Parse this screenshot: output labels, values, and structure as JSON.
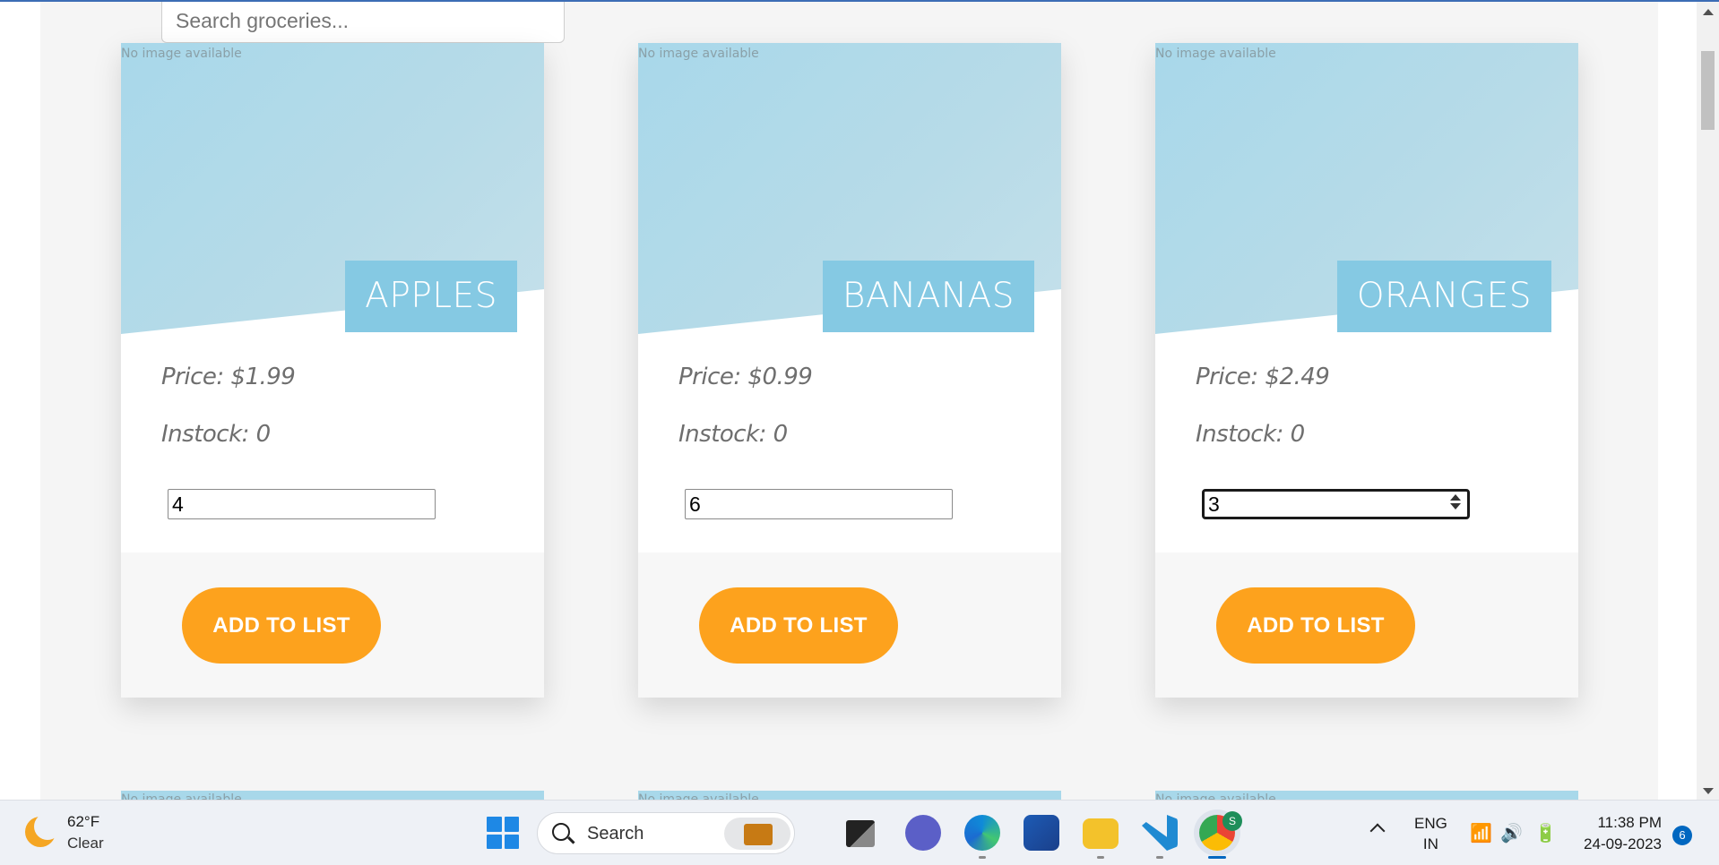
{
  "search": {
    "placeholder": "Search groceries..."
  },
  "products": [
    {
      "name": "APPLES",
      "image_text": "No image available",
      "price": "Price: $1.99",
      "stock": "Instock: 0",
      "quantity": "4",
      "button": "ADD TO LIST"
    },
    {
      "name": "BANANAS",
      "image_text": "No image available",
      "price": "Price: $0.99",
      "stock": "Instock: 0",
      "quantity": "6",
      "button": "ADD TO LIST"
    },
    {
      "name": "ORANGES",
      "image_text": "No image available",
      "price": "Price: $2.49",
      "stock": "Instock: 0",
      "quantity": "3",
      "button": "ADD TO LIST"
    }
  ],
  "next_row": {
    "image_text": "No image available"
  },
  "colors": {
    "accent": "#fda21d",
    "banner": "#85c9e3",
    "image_bg": "#a8d8ea"
  },
  "taskbar": {
    "weather": {
      "temp": "62°F",
      "condition": "Clear",
      "icon": "moon-icon"
    },
    "search_label": "Search",
    "apps": [
      "start-icon",
      "briefcase-icon",
      "task-view-icon",
      "teams-icon",
      "edge-icon",
      "store-icon",
      "file-explorer-icon",
      "vscode-icon",
      "chrome-icon"
    ],
    "chrome_badge": "S",
    "lang_line1": "ENG",
    "lang_line2": "IN",
    "time": "11:38 PM",
    "date": "24-09-2023",
    "notifications": "6"
  }
}
